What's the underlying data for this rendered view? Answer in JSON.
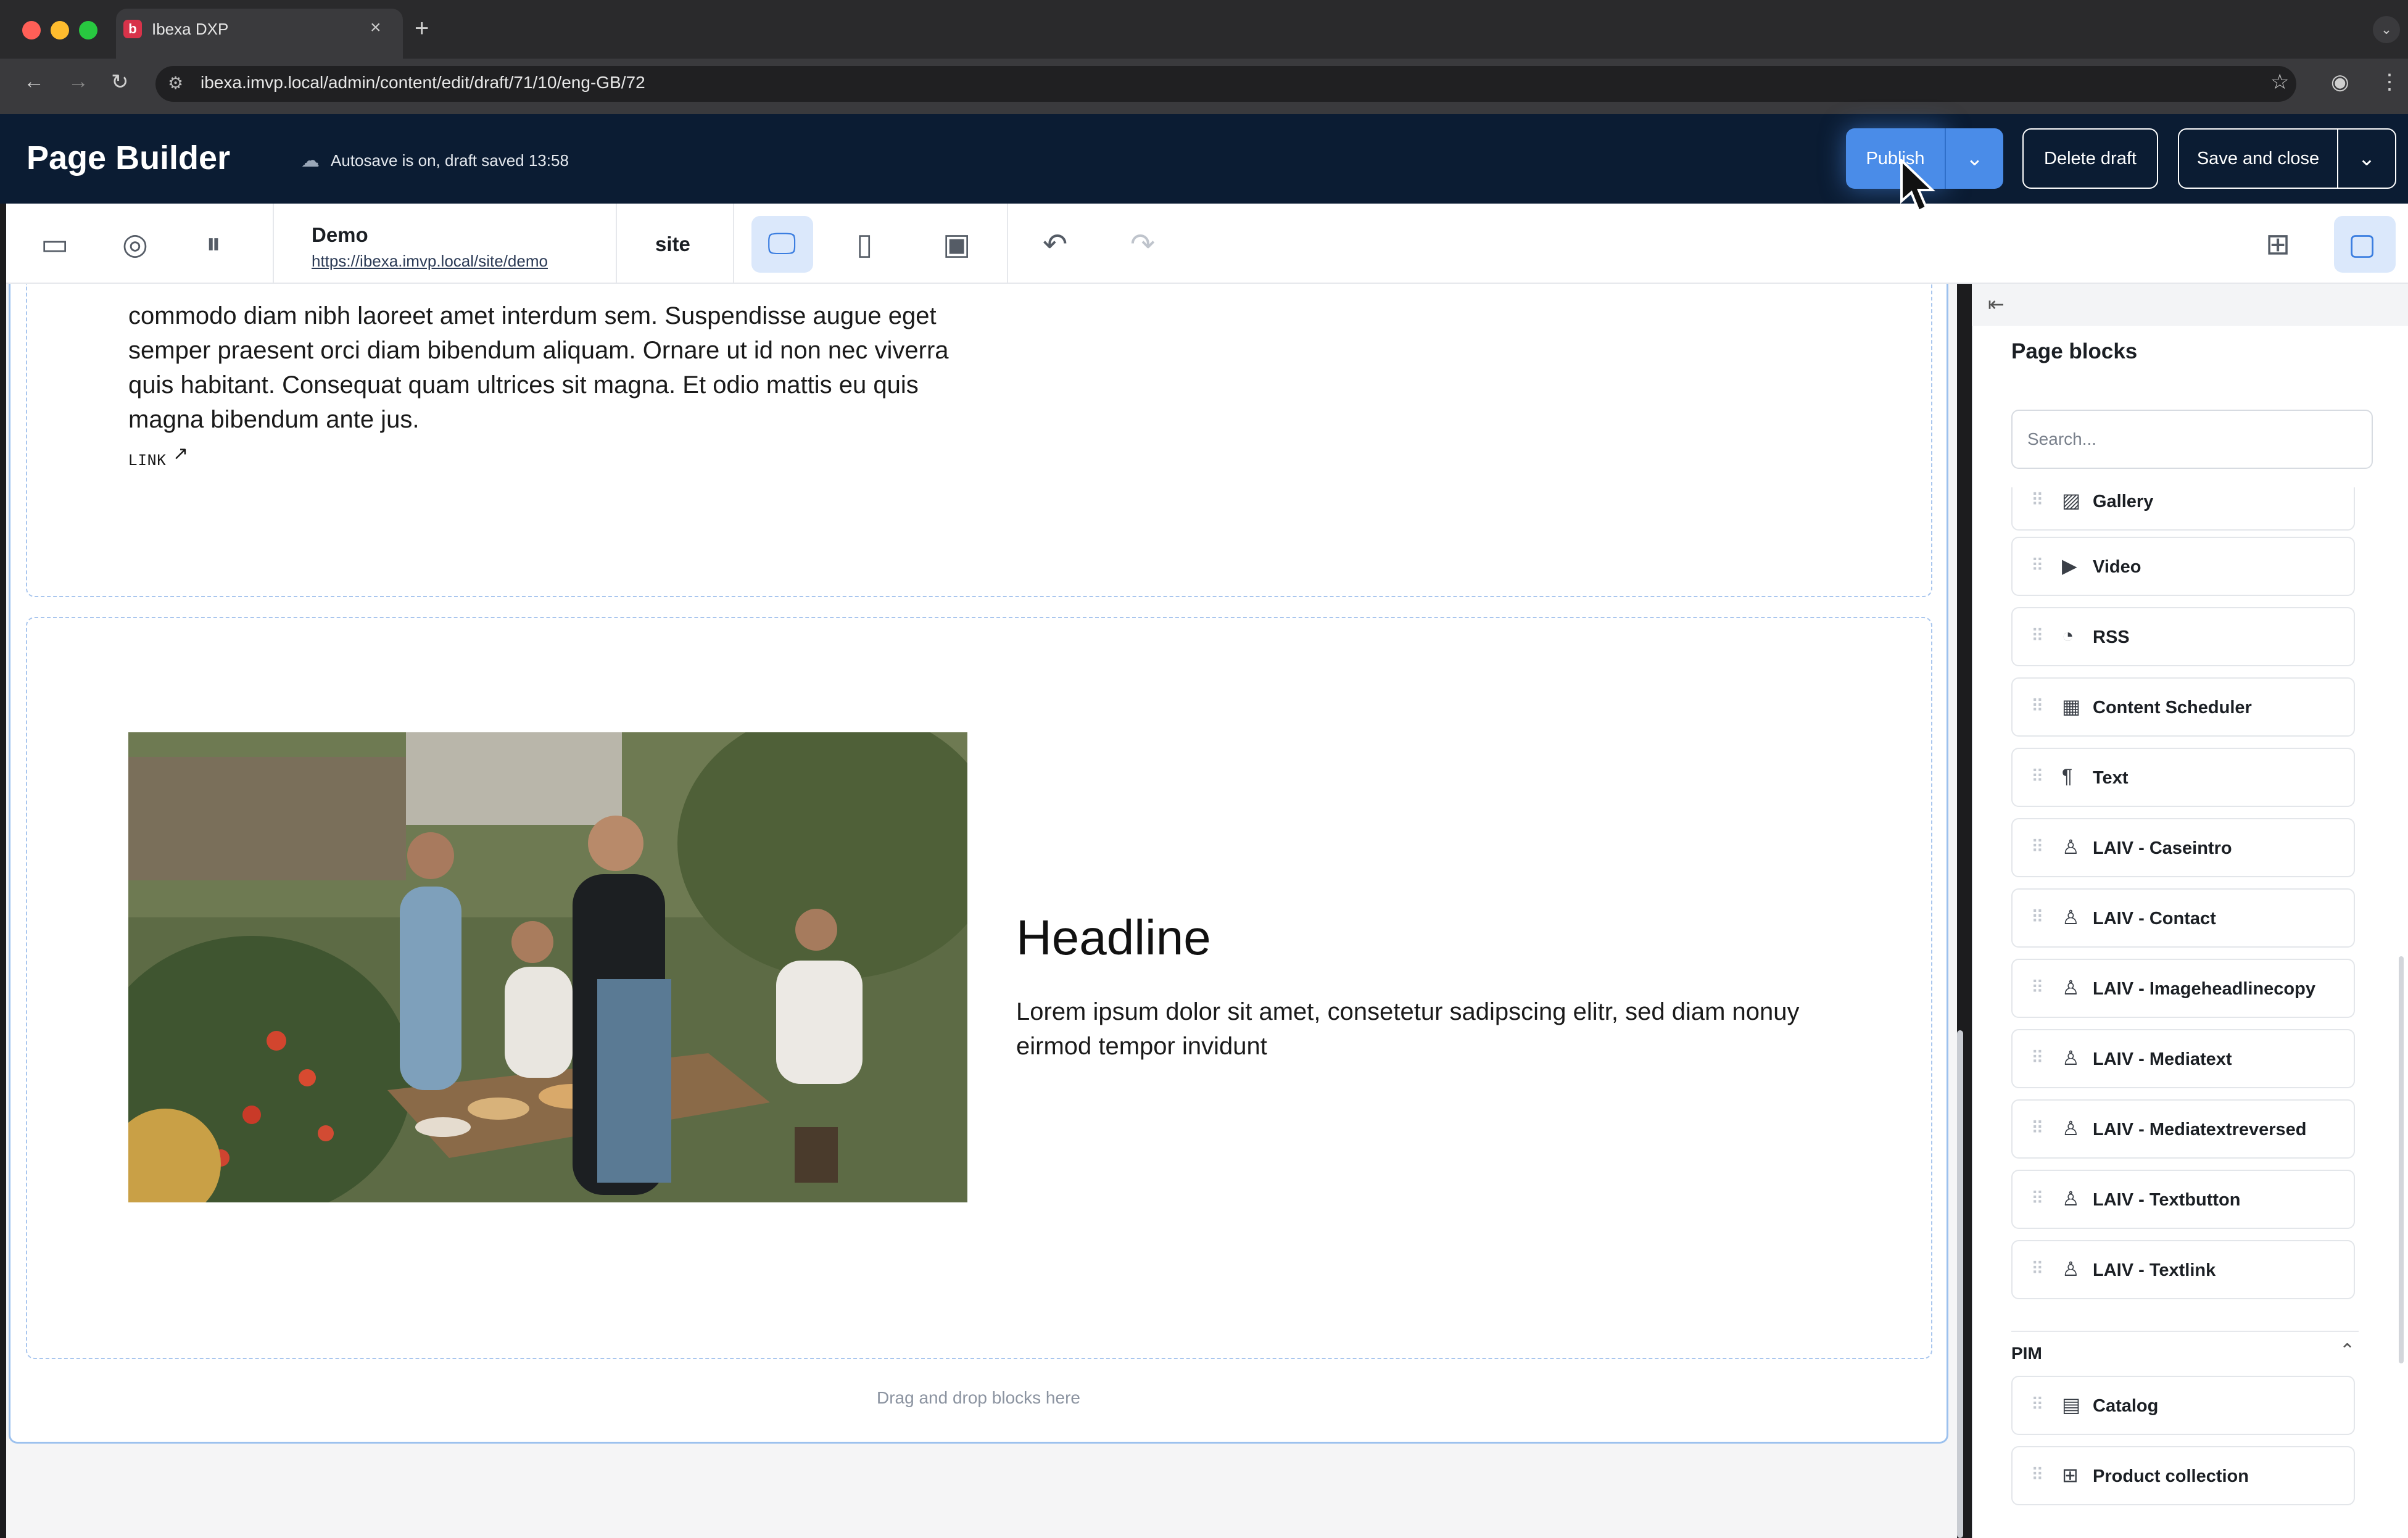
{
  "browser": {
    "tab_title": "Ibexa DXP",
    "tab_favicon": "b",
    "url": "ibexa.imvp.local/admin/content/edit/draft/71/10/eng-GB/72",
    "icons": [
      "back-icon",
      "forward-icon",
      "reload-icon",
      "site-settings-icon",
      "bookmark-star-icon",
      "profile-icon",
      "more-icon"
    ]
  },
  "header": {
    "title": "Page Builder",
    "autosave": "Autosave is on, draft saved 13:58",
    "publish": "Publish",
    "delete_draft": "Delete draft",
    "save_close": "Save and close"
  },
  "toolbar": {
    "site_name": "Demo",
    "site_url": "https://ibexa.imvp.local/site/demo",
    "site_label": "site"
  },
  "content": {
    "body_text": "commodo diam nibh laoreet amet interdum sem. Suspendisse augue eget semper praesent orci diam bibendum aliquam. Ornare ut id non nec viverra quis habitant. Consequat quam ultrices sit magna. Et odio mattis eu quis magna bibendum ante jus.",
    "link": "LINK",
    "headline": "Headline",
    "copy": "Lorem ipsum dolor sit amet, consetetur sadipscing elitr, sed diam nonuy eirmod tempor invidunt",
    "dropzone": "Drag and drop blocks here"
  },
  "sidebar": {
    "title": "Page blocks",
    "search_placeholder": "Search...",
    "blocks": [
      {
        "label": "Gallery",
        "icon": "gallery-icon"
      },
      {
        "label": "Video",
        "icon": "video-icon"
      },
      {
        "label": "RSS",
        "icon": "rss-icon"
      },
      {
        "label": "Content Scheduler",
        "icon": "calendar-icon"
      },
      {
        "label": "Text",
        "icon": "paragraph-icon"
      },
      {
        "label": "LAIV - Caseintro",
        "icon": "laiv-icon"
      },
      {
        "label": "LAIV - Contact",
        "icon": "laiv-icon"
      },
      {
        "label": "LAIV - Imageheadlinecopy",
        "icon": "laiv-icon"
      },
      {
        "label": "LAIV - Mediatext",
        "icon": "laiv-icon"
      },
      {
        "label": "LAIV - Mediatextreversed",
        "icon": "laiv-icon"
      },
      {
        "label": "LAIV - Textbutton",
        "icon": "laiv-icon"
      },
      {
        "label": "LAIV - Textlink",
        "icon": "laiv-icon"
      }
    ],
    "group": "PIM",
    "pim_blocks": [
      {
        "label": "Catalog",
        "icon": "catalog-icon"
      },
      {
        "label": "Product collection",
        "icon": "product-collection-icon"
      }
    ]
  },
  "colors": {
    "header_bg": "#0b1c33",
    "accent": "#4a8ce8",
    "active_tool": "#dbe8fb",
    "dash_border": "#a9c6ee"
  }
}
